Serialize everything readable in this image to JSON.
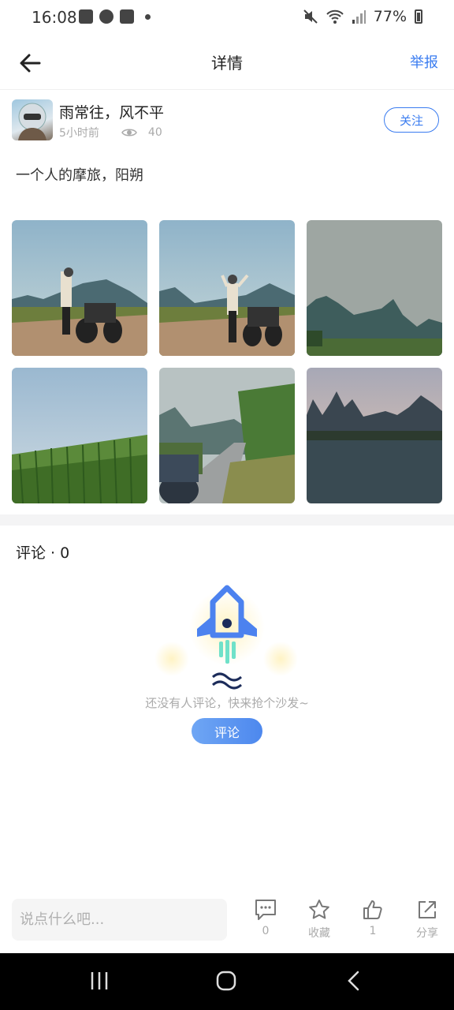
{
  "status_bar": {
    "time": "16:08",
    "battery": "77%",
    "icons": [
      "gallery-icon",
      "cloud-icon",
      "check-icon",
      "dot-icon",
      "mute-icon",
      "wifi-icon",
      "signal-icon",
      "battery-icon"
    ]
  },
  "header": {
    "title": "详情",
    "report": "举报"
  },
  "author": {
    "name": "雨常往，风不平",
    "time_ago": "5小时前",
    "views": "40",
    "follow": "关注"
  },
  "post": {
    "text": "一个人的摩旅，阳朔",
    "photos": [
      "photo-rider-waving",
      "photo-rider-arms-up",
      "photo-karst-hills",
      "photo-sugarcane-field",
      "photo-road-motorcycle",
      "photo-river-sunset"
    ]
  },
  "comments": {
    "title": "评论 · 0",
    "empty_text": "还没有人评论，快来抢个沙发~",
    "button": "评论"
  },
  "bottom": {
    "placeholder": "说点什么吧...",
    "comment_count": "0",
    "favorite": "收藏",
    "likes": "1",
    "share": "分享"
  },
  "colors": {
    "accent": "#3a7cf0",
    "muted": "#aaaaaa"
  }
}
